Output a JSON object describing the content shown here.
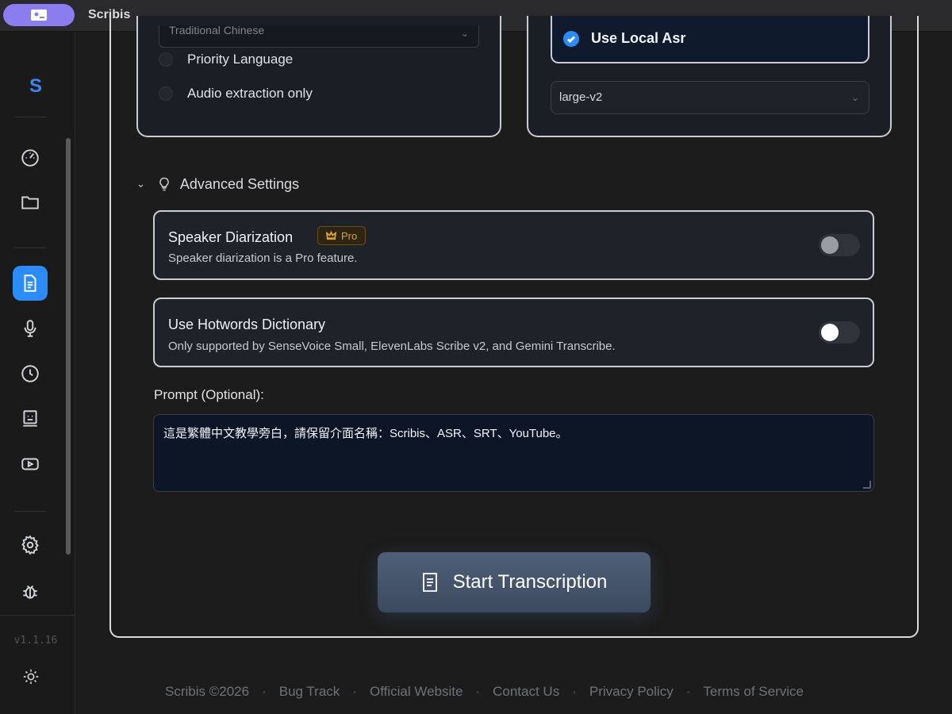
{
  "window": {
    "title": "Scribis"
  },
  "sidebar": {
    "logo": "S",
    "version": "v1.1.16",
    "items": [
      {
        "name": "dashboard",
        "icon": "gauge-icon"
      },
      {
        "name": "files",
        "icon": "folder-icon"
      },
      {
        "name": "transcribe",
        "icon": "document-icon",
        "active": true
      },
      {
        "name": "record",
        "icon": "microphone-icon"
      },
      {
        "name": "history",
        "icon": "clock-icon"
      },
      {
        "name": "subtitle-editor",
        "icon": "monitor-icon"
      },
      {
        "name": "youtube",
        "icon": "youtube-icon"
      },
      {
        "name": "settings",
        "icon": "gear-icon"
      },
      {
        "name": "debug",
        "icon": "bug-icon"
      },
      {
        "name": "theme",
        "icon": "sun-icon"
      }
    ]
  },
  "language_card": {
    "selected_language": "Traditional Chinese",
    "options": [
      {
        "label": "Priority Language",
        "checked": false
      },
      {
        "label": "Audio extraction only",
        "checked": false
      }
    ]
  },
  "asr_card": {
    "use_local_asr_label": "Use Local Asr",
    "use_local_asr_checked": true,
    "model": "large-v2"
  },
  "advanced": {
    "title": "Advanced Settings",
    "speaker_diarization": {
      "title": "Speaker Diarization",
      "badge": "Pro",
      "description": "Speaker diarization is a Pro feature.",
      "enabled": false
    },
    "hotwords": {
      "title": "Use Hotwords Dictionary",
      "description": "Only supported by SenseVoice Small, ElevenLabs Scribe v2, and Gemini Transcribe.",
      "enabled": false
    },
    "prompt_label": "Prompt (Optional):",
    "prompt_value": "這是繁體中文教學旁白，請保留介面名稱：Scribis、ASR、SRT、YouTube。"
  },
  "actions": {
    "start_label": "Start Transcription"
  },
  "footer": {
    "copyright": "Scribis ©2026",
    "links": [
      "Bug Track",
      "Official Website",
      "Contact Us",
      "Privacy Policy",
      "Terms of Service"
    ],
    "separator": "·"
  },
  "colors": {
    "accent": "#2b8cf7",
    "pro_badge": "#d4a33a",
    "title_pill": "#8b7cf0",
    "background": "#1c1c1c"
  }
}
